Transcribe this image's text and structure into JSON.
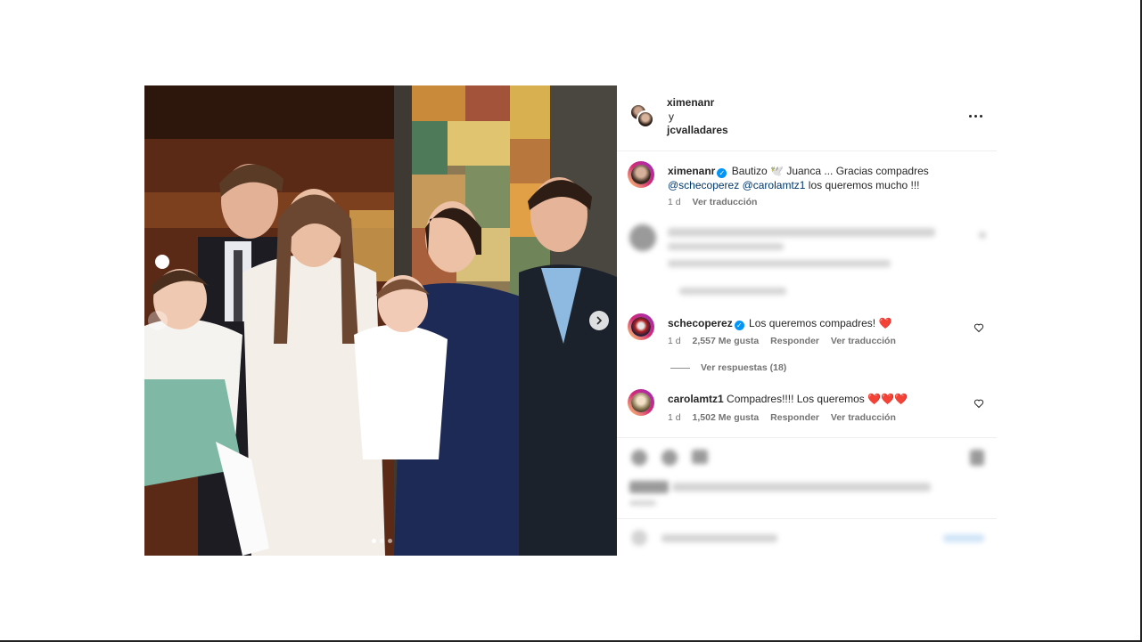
{
  "post": {
    "header": {
      "user1": "ximenanr",
      "conjunction": "y",
      "user2": "jcvalladares"
    },
    "caption": {
      "username": "ximenanr",
      "text_part1": "Bautizo 🕊️ Juanca ... Gracias compadres",
      "mention1": "@schecoperez",
      "mention2": "@carolamtz1",
      "text_part2": "los queremos mucho !!!",
      "time": "1 d",
      "translate": "Ver traducción"
    },
    "comments": [
      {
        "username": "schecoperez",
        "text": "Los queremos compadres! ❤️",
        "time": "1 d",
        "likes": "2,557 Me gusta",
        "reply": "Responder",
        "translate": "Ver traducción",
        "view_replies": "Ver respuestas (18)"
      },
      {
        "username": "carolamtz1",
        "text": "Compadres!!!! Los queremos ❤️❤️❤️",
        "time": "1 d",
        "likes": "1,502 Me gusta",
        "reply": "Responder",
        "translate": "Ver traducción"
      }
    ],
    "carousel": {
      "total_slides": 3,
      "current_slide": 1
    }
  },
  "colors": {
    "text": "#262626",
    "secondary": "#737373",
    "mention": "#00376b",
    "verified": "#0095f6",
    "heart_red": "#ed4956"
  },
  "icons": [
    "more-options-icon",
    "verified-badge-icon",
    "heart-icon",
    "chevron-right-icon"
  ]
}
